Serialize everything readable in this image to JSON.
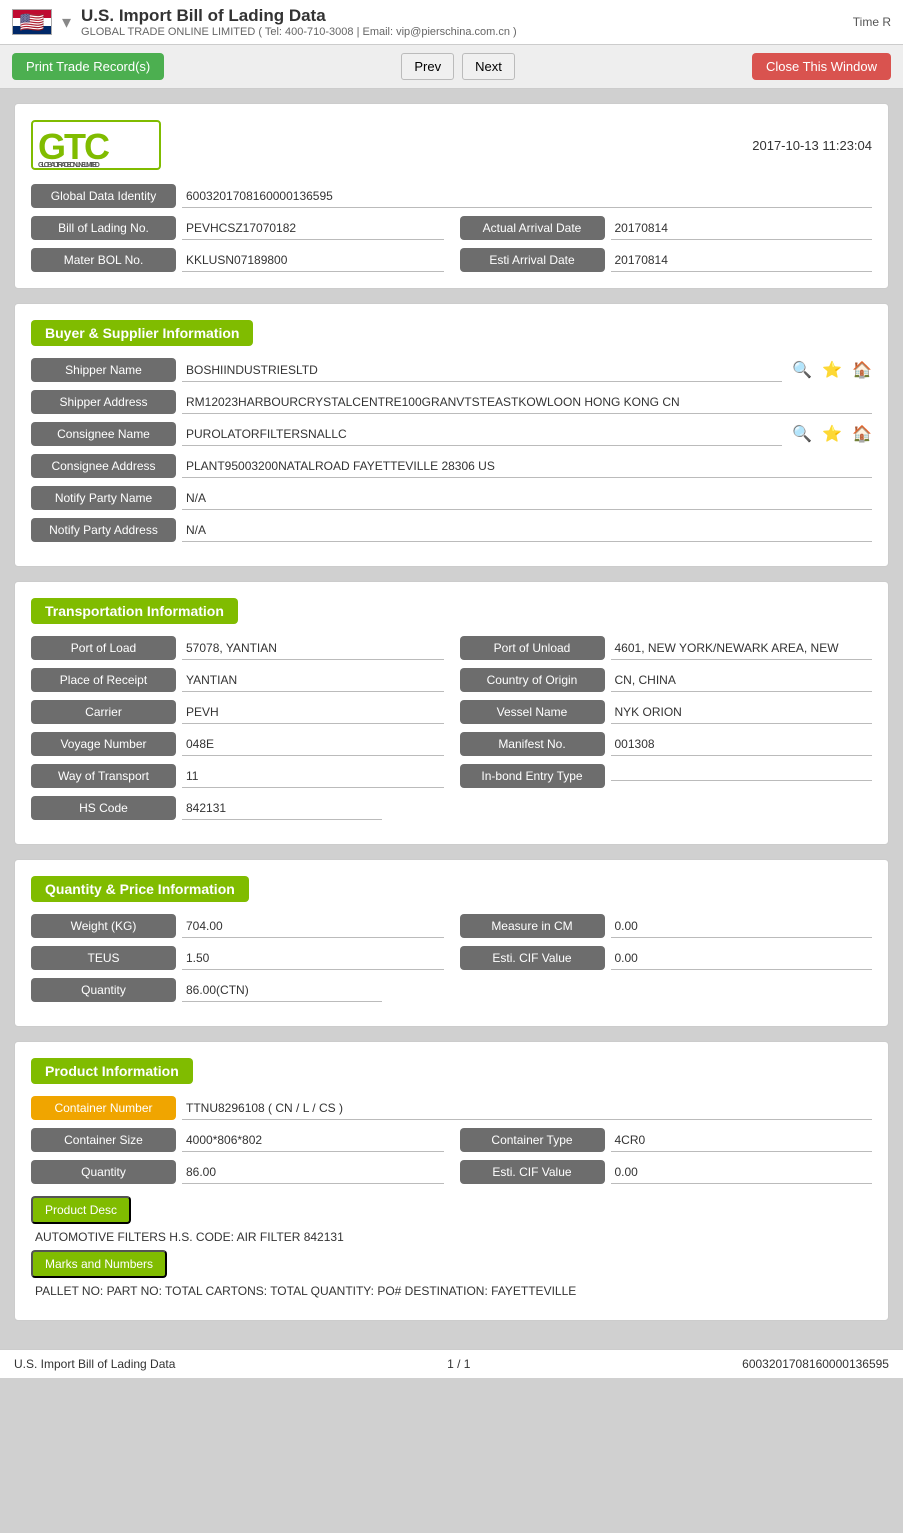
{
  "header": {
    "flag": "🇺🇸",
    "title": "U.S. Import Bill of Lading Data",
    "subtitle": "GLOBAL TRADE ONLINE LIMITED ( Tel: 400-710-3008 | Email: vip@pierschina.com.cn )",
    "time_label": "Time R"
  },
  "toolbar": {
    "print_label": "Print Trade Record(s)",
    "prev_label": "Prev",
    "next_label": "Next",
    "close_label": "Close This Window"
  },
  "logo": {
    "text": "GTC",
    "subtitle": "GLOBAL TRADE ONLINE LIMITED",
    "timestamp": "2017-10-13 11:23:04"
  },
  "global_data_identity": {
    "label": "Global Data Identity",
    "value": "6003201708160000136595"
  },
  "bill_of_lading": {
    "label": "Bill of Lading No.",
    "value": "PEVHCSZ17070182",
    "arrival_label": "Actual Arrival Date",
    "arrival_value": "20170814"
  },
  "master_bol": {
    "label": "Mater BOL No.",
    "value": "KKLUSN07189800",
    "esti_label": "Esti Arrival Date",
    "esti_value": "20170814"
  },
  "buyer_supplier": {
    "section_title": "Buyer & Supplier Information",
    "shipper_name_label": "Shipper Name",
    "shipper_name_value": "BOSHIINDUSTRIESLTD",
    "shipper_address_label": "Shipper Address",
    "shipper_address_value": "RM12023HARBOURCRYSTALCENTRE100GRANVTSTEASTKOWLOON HONG KONG CN",
    "consignee_name_label": "Consignee Name",
    "consignee_name_value": "PUROLATORFILTERSNALLC",
    "consignee_address_label": "Consignee Address",
    "consignee_address_value": "PLANT95003200NATALROAD FAYETTEVILLE 28306 US",
    "notify_party_name_label": "Notify Party Name",
    "notify_party_name_value": "N/A",
    "notify_party_address_label": "Notify Party Address",
    "notify_party_address_value": "N/A"
  },
  "transportation": {
    "section_title": "Transportation Information",
    "port_of_load_label": "Port of Load",
    "port_of_load_value": "57078, YANTIAN",
    "port_of_unload_label": "Port of Unload",
    "port_of_unload_value": "4601, NEW YORK/NEWARK AREA, NEW",
    "place_of_receipt_label": "Place of Receipt",
    "place_of_receipt_value": "YANTIAN",
    "country_of_origin_label": "Country of Origin",
    "country_of_origin_value": "CN, CHINA",
    "carrier_label": "Carrier",
    "carrier_value": "PEVH",
    "vessel_name_label": "Vessel Name",
    "vessel_name_value": "NYK ORION",
    "voyage_number_label": "Voyage Number",
    "voyage_number_value": "048E",
    "manifest_no_label": "Manifest No.",
    "manifest_no_value": "001308",
    "way_of_transport_label": "Way of Transport",
    "way_of_transport_value": "11",
    "inbond_entry_label": "In-bond Entry Type",
    "inbond_entry_value": "",
    "hs_code_label": "HS Code",
    "hs_code_value": "842131"
  },
  "quantity_price": {
    "section_title": "Quantity & Price Information",
    "weight_label": "Weight (KG)",
    "weight_value": "704.00",
    "measure_label": "Measure in CM",
    "measure_value": "0.00",
    "teus_label": "TEUS",
    "teus_value": "1.50",
    "esti_cif_label": "Esti. CIF Value",
    "esti_cif_value": "0.00",
    "quantity_label": "Quantity",
    "quantity_value": "86.00(CTN)"
  },
  "product_info": {
    "section_title": "Product Information",
    "container_number_label": "Container Number",
    "container_number_value": "TTNU8296108 ( CN / L / CS )",
    "container_size_label": "Container Size",
    "container_size_value": "4000*806*802",
    "container_type_label": "Container Type",
    "container_type_value": "4CR0",
    "quantity_label": "Quantity",
    "quantity_value": "86.00",
    "esti_cif_label": "Esti. CIF Value",
    "esti_cif_value": "0.00",
    "product_desc_label": "Product Desc",
    "product_desc_value": "AUTOMOTIVE FILTERS H.S. CODE: AIR FILTER 842131",
    "marks_label": "Marks and Numbers",
    "marks_value": "PALLET NO: PART NO: TOTAL CARTONS: TOTAL QUANTITY: PO# DESTINATION: FAYETTEVILLE"
  },
  "footer": {
    "page_title": "U.S. Import Bill of Lading Data",
    "page_info": "1 / 1",
    "record_id": "6003201708160000136595"
  }
}
